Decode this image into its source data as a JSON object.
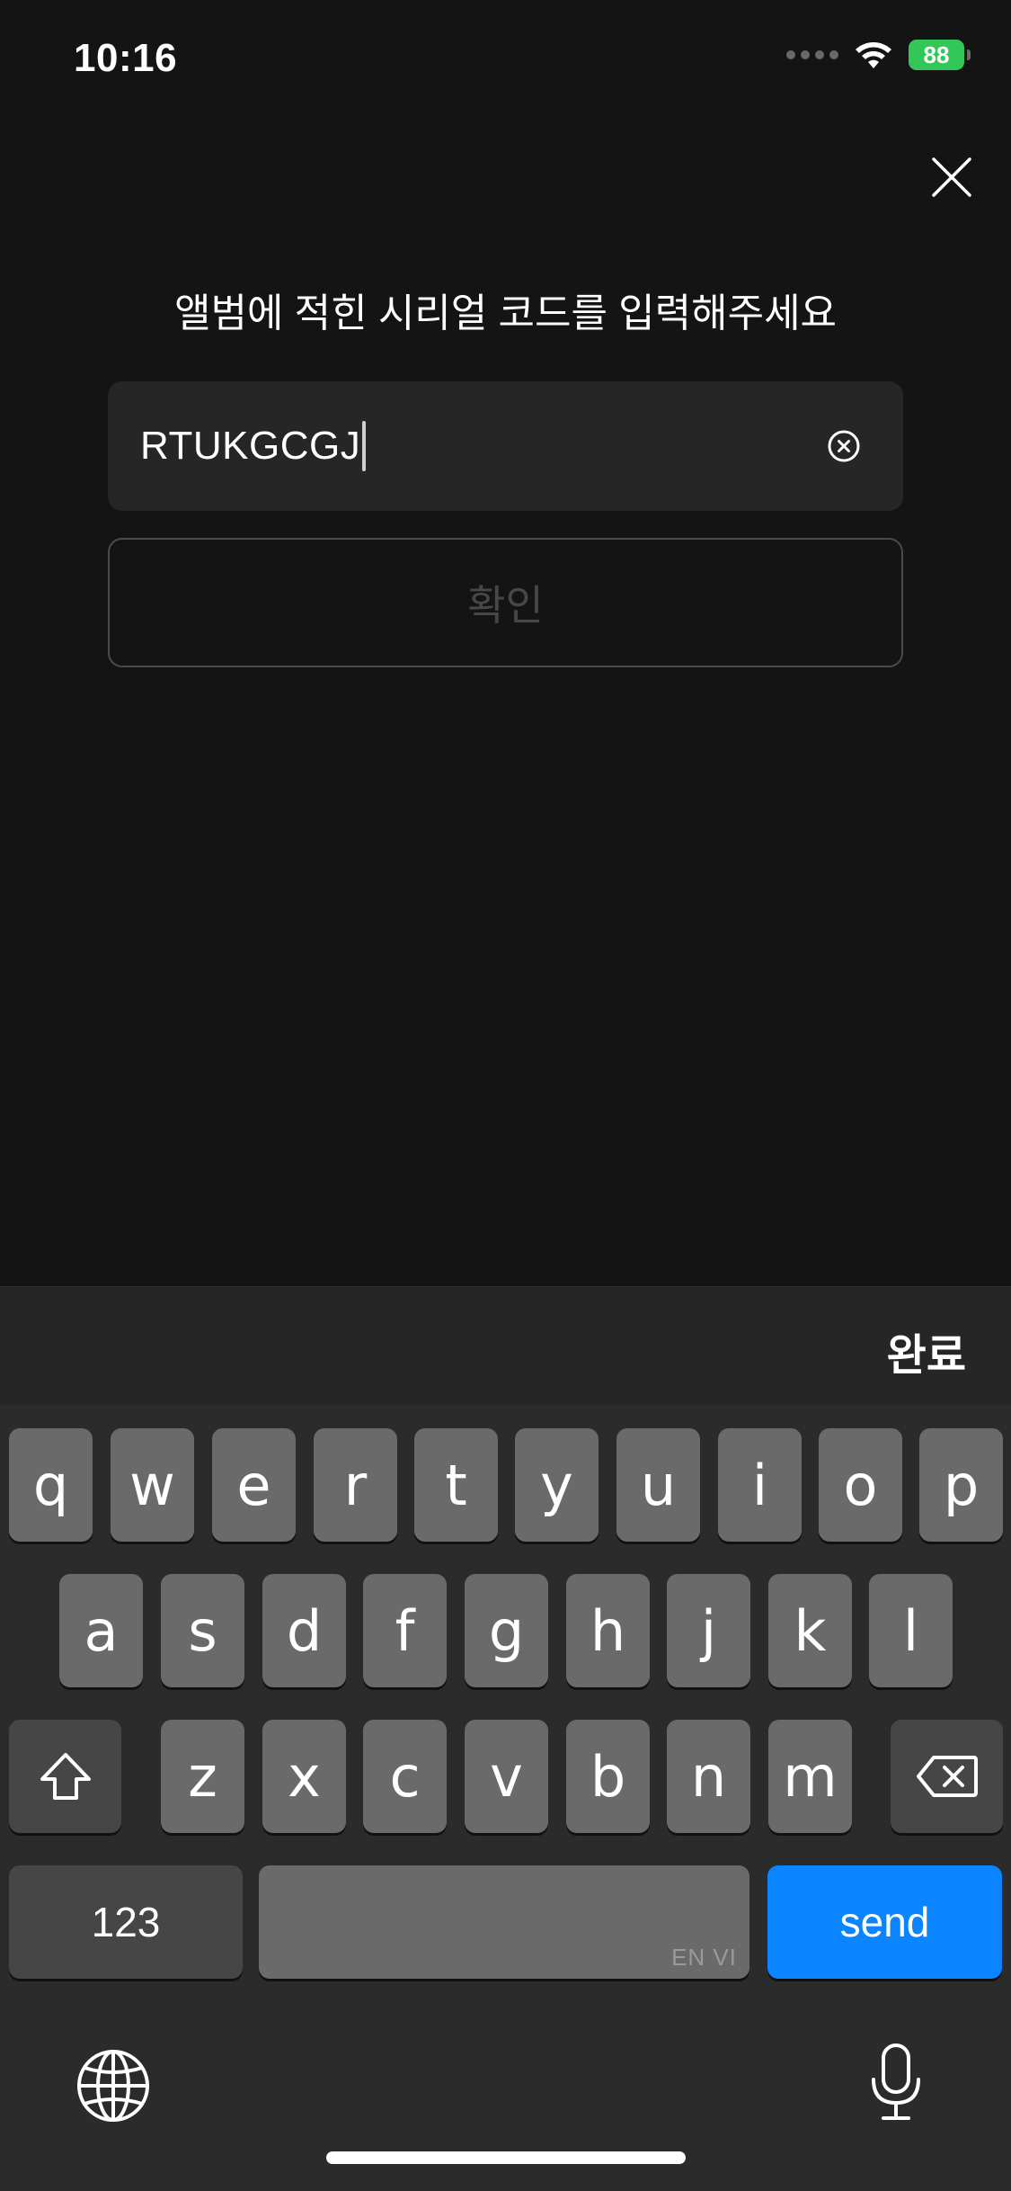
{
  "status_bar": {
    "time": "10:16",
    "battery": "88"
  },
  "prompt": "앨범에 적힌 시리얼 코드를 입력해주세요",
  "code_input": {
    "value": "RTUKGCGJ"
  },
  "confirm_label": "확인",
  "keyboard": {
    "done_label": "완료",
    "row1": [
      "q",
      "w",
      "e",
      "r",
      "t",
      "y",
      "u",
      "i",
      "o",
      "p"
    ],
    "row2": [
      "a",
      "s",
      "d",
      "f",
      "g",
      "h",
      "j",
      "k",
      "l"
    ],
    "row3": [
      "z",
      "x",
      "c",
      "v",
      "b",
      "n",
      "m"
    ],
    "numbers_label": "123",
    "space_hint": "EN VI",
    "send_label": "send"
  },
  "colors": {
    "accent": "#0a84ff",
    "battery": "#33c759",
    "background": "#141414"
  },
  "icons": [
    "close-icon",
    "clear-icon",
    "wifi-icon",
    "shift-icon",
    "delete-icon",
    "globe-icon",
    "microphone-icon"
  ]
}
